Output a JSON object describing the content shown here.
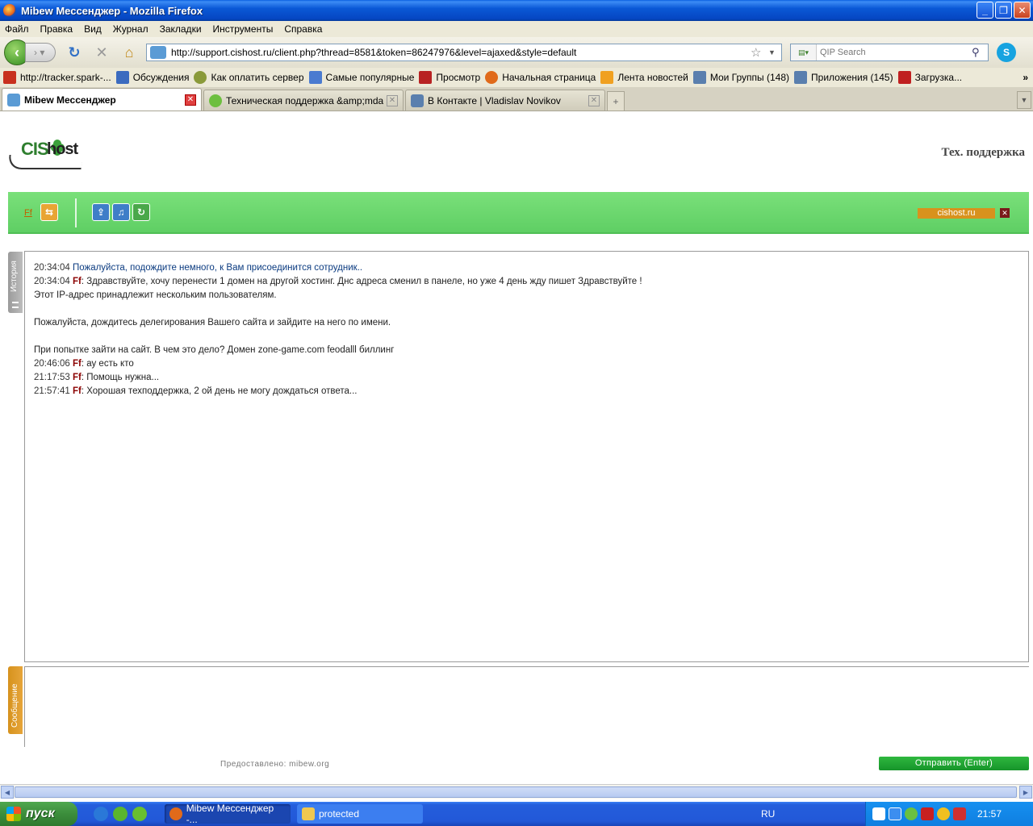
{
  "window": {
    "title": "Mibew Мессенджер - Mozilla Firefox",
    "controls": [
      "_",
      "❐",
      "✕"
    ]
  },
  "menu": [
    "Файл",
    "Правка",
    "Вид",
    "Журнал",
    "Закладки",
    "Инструменты",
    "Справка"
  ],
  "nav": {
    "url": "http://support.cishost.ru/client.php?thread=8581&token=86247976&level=ajaxed&style=default",
    "search_placeholder": "QIP Search"
  },
  "bookmarks": [
    {
      "label": "http://tracker.spark-...",
      "color": "#c8301e"
    },
    {
      "label": "Обсуждения",
      "color": "#3b6bbf"
    },
    {
      "label": "Как оплатить сервер",
      "color": "#8a9a3a"
    },
    {
      "label": "Самые популярные",
      "color": "#4a7bd0"
    },
    {
      "label": "Просмотр",
      "color": "#b82222"
    },
    {
      "label": "Начальная страница",
      "color": "#e06a1a"
    },
    {
      "label": "Лента новостей",
      "color": "#f0a020"
    },
    {
      "label": "Мои Группы (148)",
      "color": "#5a7fae"
    },
    {
      "label": "Приложения (145)",
      "color": "#5a7fae"
    },
    {
      "label": "Загрузка...",
      "color": "#c02020"
    }
  ],
  "bookmarks_more": "»",
  "tabs": [
    {
      "label": "Mibew Мессенджер",
      "active": true,
      "color": "#5a9bd5"
    },
    {
      "label": "Техническая поддержка &amp;mdas...",
      "active": false,
      "color": "#6dbf3f"
    },
    {
      "label": "В Контакте | Vladislav Novikov",
      "active": false,
      "color": "#5a7fae"
    }
  ],
  "page": {
    "logo": {
      "cis": "CIS",
      "host": "host"
    },
    "title": "Тех. поддержка",
    "toolbar": {
      "user_name": "Ff",
      "site_label": "cishost.ru",
      "close_glyph": "✕"
    },
    "history_label": "История",
    "message_label": "Сообщение",
    "chat": [
      {
        "time": "20:34:04",
        "name": "",
        "text": "Пожалуйста, подождите немного, к Вам присоединится сотрудник..",
        "system": true
      },
      {
        "time": "20:34:04",
        "name": "Ff",
        "text": "Здравствуйте, хочу перенести 1 домен на другой хостинг. Днс адреса сменил в панеле, но уже 4 день жду пишет Здравствуйте !",
        "system": false
      },
      {
        "time": "",
        "name": "",
        "text": "Этот IP-адрес принадлежит нескольким пользователям.",
        "system": false
      },
      {
        "time": "",
        "name": "",
        "text": "",
        "system": false
      },
      {
        "time": "",
        "name": "",
        "text": "Пожалуйста, дождитесь делегирования Вашего сайта и зайдите на него по имени.",
        "system": false
      },
      {
        "time": "",
        "name": "",
        "text": "",
        "system": false
      },
      {
        "time": "",
        "name": "",
        "text": "При попытке зайти на сайт. В чем это дело? Домен zone-game.com feodalll биллинг",
        "system": false
      },
      {
        "time": "20:46:06",
        "name": "Ff",
        "text": "ау есть кто",
        "system": false
      },
      {
        "time": "21:17:53",
        "name": "Ff",
        "text": "Помощь нужна...",
        "system": false
      },
      {
        "time": "21:57:41",
        "name": "Ff",
        "text": "Хорошая техподдержка, 2 ой день не могу дождаться ответа...",
        "system": false
      }
    ],
    "powered_prefix": "Предоставлено:",
    "powered_link": "mibew.org",
    "send_button": "Отправить (Enter)"
  },
  "taskbar": {
    "start": "пуск",
    "tasks": [
      {
        "label": "Mibew Мессенджер -...",
        "active": true
      },
      {
        "label": "protected",
        "active": false
      }
    ],
    "lang": "RU",
    "clock": "21:57"
  }
}
